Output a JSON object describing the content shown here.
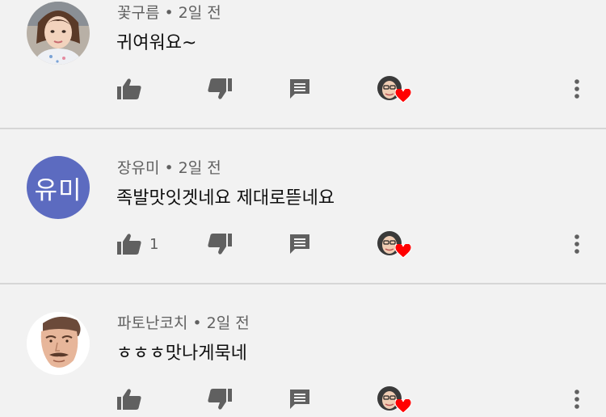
{
  "comments": [
    {
      "author": "꽃구름",
      "time": "2일 전",
      "text": "귀여워요~",
      "likes": ""
    },
    {
      "author": "장유미",
      "time": "2일 전",
      "text": "족발맛잇겟네요 제대로뜯네요",
      "likes": "1",
      "avatar_initials": "유미"
    },
    {
      "author": "파토난코치",
      "time": "2일 전",
      "text": "ㅎㅎㅎ맛나게묵네",
      "likes": ""
    }
  ],
  "separator": "•",
  "icons": {
    "like": "thumbs-up-icon",
    "dislike": "thumbs-down-icon",
    "reply": "reply-icon",
    "hearted": "creator-heart-icon",
    "more": "more-vert-icon"
  },
  "colors": {
    "background": "#f2f2f2",
    "icon": "#606060",
    "heart": "#ff0000",
    "letter_avatar": "#5c6bc0"
  }
}
